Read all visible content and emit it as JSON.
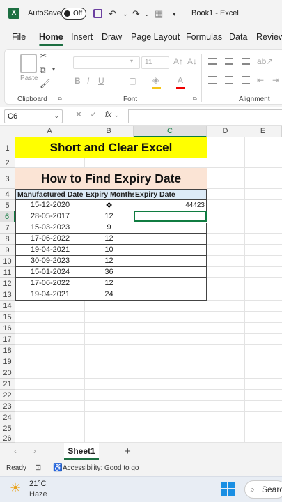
{
  "titlebar": {
    "autosave_label": "AutoSave",
    "toggle_state": "Off",
    "doc_title": "Book1 - Excel"
  },
  "ribbon_tabs": [
    "File",
    "Home",
    "Insert",
    "Draw",
    "Page Layout",
    "Formulas",
    "Data",
    "Review"
  ],
  "active_tab": "Home",
  "ribbon": {
    "paste_label": "Paste",
    "font_size": "11",
    "groups": {
      "clipboard": "Clipboard",
      "font": "Font",
      "alignment": "Alignment"
    }
  },
  "formula_bar": {
    "name_box": "C6",
    "fx": "fx",
    "formula": ""
  },
  "columns": [
    "A",
    "B",
    "C",
    "D",
    "E"
  ],
  "rows": [
    "1",
    "2",
    "3",
    "4",
    "5",
    "6",
    "7",
    "8",
    "9",
    "10",
    "11",
    "12",
    "13",
    "14",
    "15",
    "16",
    "17",
    "18",
    "19",
    "20",
    "21",
    "22",
    "23",
    "24",
    "25",
    "26"
  ],
  "sheet": {
    "title_banner": "Short and Clear Excel",
    "subtitle_banner": "How to Find Expiry Date",
    "headers": [
      "Manufactured Date",
      "Expiry Months",
      "Expiry Date"
    ],
    "table": [
      {
        "mfg": "15-12-2020",
        "months": "",
        "expiry": "44423"
      },
      {
        "mfg": "28-05-2017",
        "months": "12",
        "expiry": ""
      },
      {
        "mfg": "15-03-2023",
        "months": "9",
        "expiry": ""
      },
      {
        "mfg": "17-06-2022",
        "months": "12",
        "expiry": ""
      },
      {
        "mfg": "19-04-2021",
        "months": "10",
        "expiry": ""
      },
      {
        "mfg": "30-09-2023",
        "months": "12",
        "expiry": ""
      },
      {
        "mfg": "15-01-2024",
        "months": "36",
        "expiry": ""
      },
      {
        "mfg": "17-06-2022",
        "months": "12",
        "expiry": ""
      },
      {
        "mfg": "19-04-2021",
        "months": "24",
        "expiry": ""
      }
    ]
  },
  "sheet_tabs": {
    "active": "Sheet1",
    "add": "+"
  },
  "status": {
    "ready": "Ready",
    "accessibility": "Accessibility: Good to go"
  },
  "taskbar": {
    "temperature": "21°C",
    "weather": "Haze",
    "search": "Searc"
  }
}
